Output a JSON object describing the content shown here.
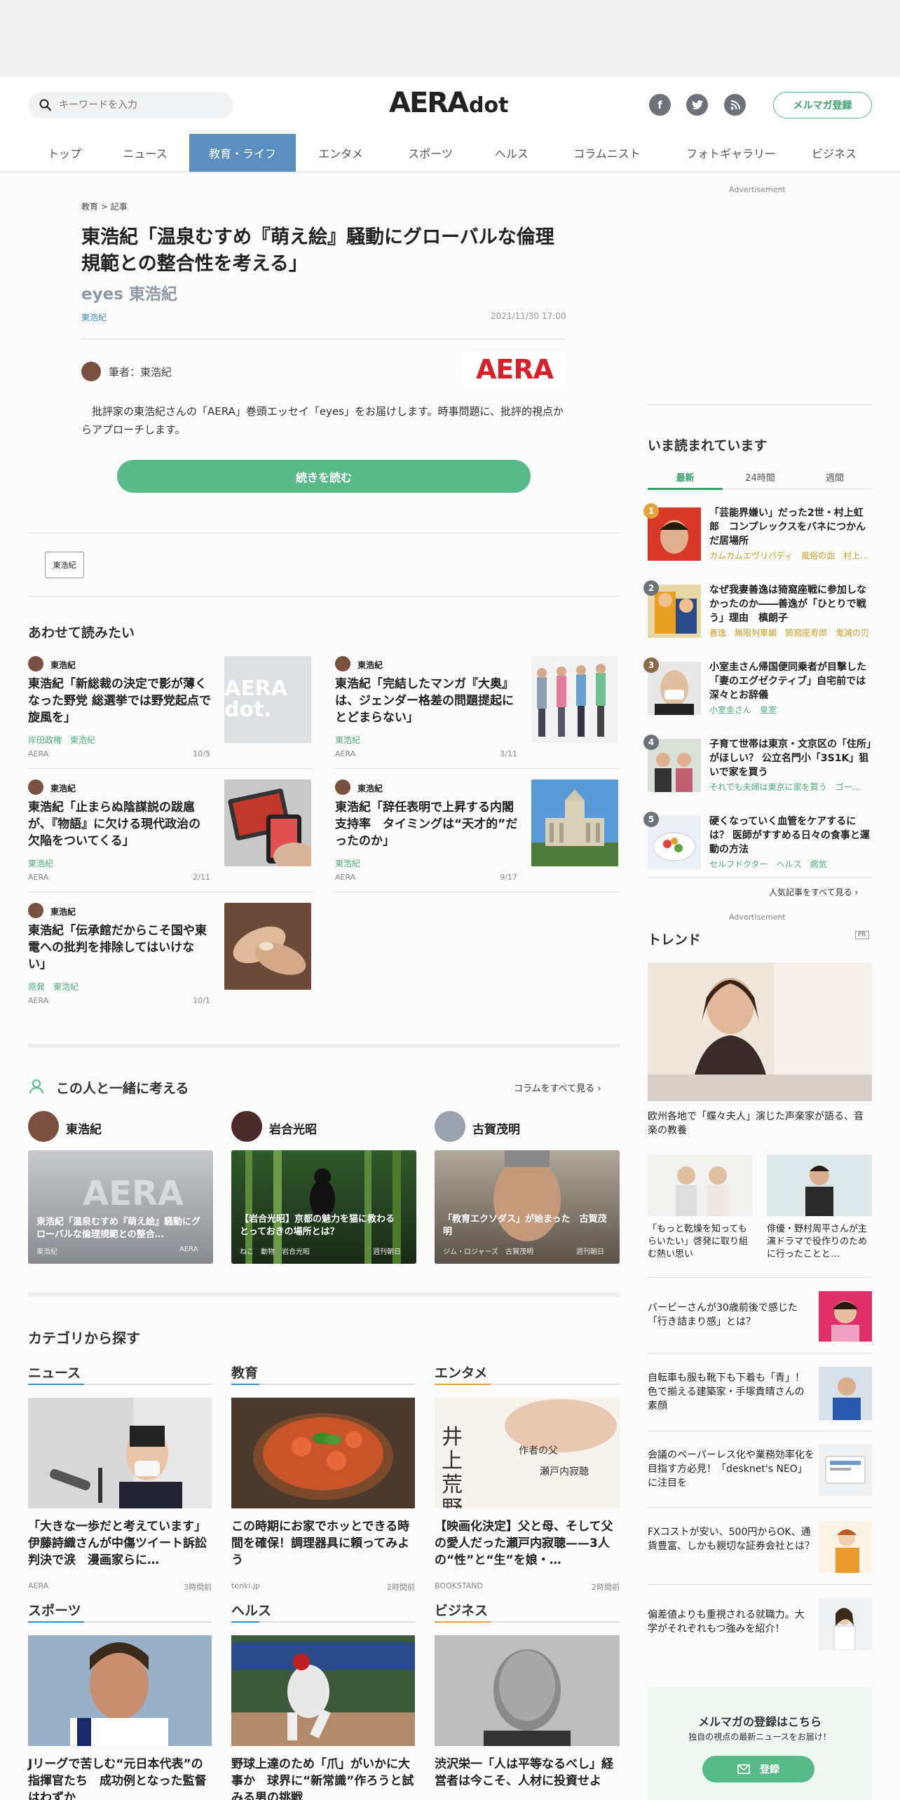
{
  "header": {
    "search_placeholder": "キーワードを入力",
    "logo_main": "AERA",
    "logo_sub": "dot",
    "mailmag_button": "メルマガ登録",
    "social": [
      "f",
      "t",
      "rss"
    ]
  },
  "nav": {
    "items": [
      "トップ",
      "ニュース",
      "教育・ライフ",
      "エンタメ",
      "スポーツ",
      "ヘルス",
      "コラムニスト",
      "フォトギャラリー",
      "ビジネス"
    ],
    "active": "教育・ライフ"
  },
  "article": {
    "breadcrumb": "教育 > 記事",
    "title": "東浩紀「温泉むすめ『萌え絵』騒動にグローバルな倫理規範との整合性を考える」",
    "subtitle": "eyes 東浩紀",
    "author_tag": "東浩紀",
    "date": "2021/11/30 17:00",
    "author_label": "筆者：東浩紀",
    "publisher_logo": "AERA",
    "lead": "批評家の東浩紀さんの「AERA」巻頭エッセイ「eyes」をお届けします。時事問題に、批評的視点からアプローチします。",
    "read_more": "続きを読む",
    "tag": "東浩紀"
  },
  "related": {
    "heading": "あわせて読みたい",
    "items": [
      {
        "author": "東浩紀",
        "title": "東浩紀「新総裁の決定で影が薄くなった野党 総選挙では野党起点で旋風を」",
        "tags": "岸田政権　東浩紀",
        "source": "AERA",
        "date": "10/5",
        "thumb": "AERA dot."
      },
      {
        "author": "東浩紀",
        "title": "東浩紀「完結したマンガ『大奥』は、ジェンダー格差の問題提起にとどまらない」",
        "tags": "東浩紀",
        "source": "AERA",
        "date": "3/11"
      },
      {
        "author": "東浩紀",
        "title": "東浩紀「止まらぬ陰謀説の跋扈が、『物語』に欠ける現代政治の欠陥をついてくる」",
        "tags": "東浩紀",
        "source": "AERA",
        "date": "2/11"
      },
      {
        "author": "東浩紀",
        "title": "東浩紀「辞任表明で上昇する内閣支持率　タイミングは“天才的”だったのか」",
        "tags": "東浩紀",
        "source": "AERA",
        "date": "9/17"
      },
      {
        "author": "東浩紀",
        "title": "東浩紀「伝承館だからこそ国や東電への批判を排除してはいけない」",
        "tags": "原発　東浩紀",
        "source": "AERA",
        "date": "10/1"
      }
    ]
  },
  "think": {
    "heading": "この人と一緒に考える",
    "see_all": "コラムをすべて見る",
    "people": [
      {
        "name": "東浩紀",
        "caption": "東浩紀「温泉むすめ『萌え絵』騒動にグローバルな倫理規範との整合…",
        "tags": "東浩紀",
        "source": "AERA"
      },
      {
        "name": "岩合光昭",
        "caption": "【岩合光昭】京都の魅力を猫に教わる　とっておきの場所とは？",
        "tags": "ねこ　動物　岩合光昭",
        "source": "週刊朝日"
      },
      {
        "name": "古賀茂明",
        "caption": "「教育エクソダス」が始まった　古賀茂明",
        "tags": "ジム・ロジャーズ　古賀茂明",
        "source": "週刊朝日"
      }
    ]
  },
  "categories": {
    "heading": "カテゴリから探す",
    "items": [
      {
        "name": "ニュース",
        "title": "「大きな一歩だと考えています」伊藤詩織さんが中傷ツイート訴訟判決で涙　漫画家らに…",
        "source": "AERA",
        "date": "3時間前",
        "color": "#3b8bc4"
      },
      {
        "name": "教育",
        "title": "この時期にお家でホッとできる時間を確保！調理器具に頼ってみよう",
        "source": "tenki.jp",
        "date": "2時間前",
        "color": "#3b8bc4"
      },
      {
        "name": "エンタメ",
        "title": "【映画化決定】父と母、そして父の愛人だった瀬戸内寂聴——3人の“性”と“生”を娘・…",
        "source": "BOOKSTAND",
        "date": "2時間前",
        "color": "#e2a43a"
      },
      {
        "name": "スポーツ",
        "title": "Jリーグで苦しむ“元日本代表”の指揮官たち　成功例となった監督はわずか",
        "source": "",
        "date": "",
        "color": "#3b8bc4"
      },
      {
        "name": "ヘルス",
        "title": "野球上達のため「爪」がいかに大事か　球界に“新常識”作ろうと試みる男の挑戦",
        "source": "",
        "date": "",
        "color": "#3b8bc4"
      },
      {
        "name": "ビジネス",
        "title": "渋沢栄一「人は平等なるべし」経営者は今こそ、人材に投資せよ",
        "source": "",
        "date": "",
        "color": "#e2a43a"
      }
    ],
    "book_text": "井上荒野"
  },
  "sidebar": {
    "ad_label": "Advertisement",
    "ranking_heading": "いま読まれています",
    "tabs": [
      "最新",
      "24時間",
      "週間"
    ],
    "active_tab": "最新",
    "ranking": [
      {
        "num": "1",
        "title": "「芸能界嫌い」だった2世・村上虹郎　コンプレックスをバネにつかんだ居場所",
        "tags": "カムカムエヴリバディ　風俗の血　村上…",
        "color": "#e2a43a"
      },
      {
        "num": "2",
        "title": "なぜ我妻善逸は猗窩座戦に参加しなかったのか――善逸が「ひとりで戦う」理由　槙朗子",
        "tags": "善逸　無限列車編　猗窩座寿郎　鬼滅の刃",
        "color": "#6d7278"
      },
      {
        "num": "3",
        "title": "小室圭さん帰国便同乗者が目撃した「妻のエグゼクティブ」自宅前では深々とお辞儀",
        "tags": "小室圭さん　皇室",
        "color": "#8a6a4a"
      },
      {
        "num": "4",
        "title": "子育て世帯は東京・文京区の「住所」がほしい？ 公立名門小「3S1K」狙いで家を買う",
        "tags": "それでも夫婦は東京に家を買う　ゴー…",
        "color": "#6d7278"
      },
      {
        "num": "5",
        "title": "硬くなっていく血管をケアするには？ 医師がすすめる日々の食事と運動の方法",
        "tags": "セルフドクター　ヘルス　病気",
        "color": "#6d7278"
      }
    ],
    "ranking_all": "人気記事をすべて見る",
    "ad_label2": "Advertisement",
    "trend_heading": "トレンド",
    "pr": "PR",
    "trend_main": "欧州各地で「蝶々夫人」演じた声楽家が語る、音楽の教養",
    "trend_pair": [
      "「もっと乾燥を知ってもらいたい」啓発に取り組む熱い思い",
      "俳優・野村周平さんが主演ドラマで役作りのために行ったことと…"
    ],
    "trend_list": [
      "バービーさんが30歳前後で感じた「行き詰まり感」とは？",
      "自転車も服も靴下も下着も「青」！色で揃える建築家・手塚貴晴さんの素顔",
      "会議のペーパーレス化や業務効率化を目指す方必見！「desknet's NEO」に注目を",
      "FXコストが安い、500円からOK、通貨豊富、しかも親切な証券会社とは？",
      "偏差値よりも重視される就職力。大学がそれぞれもつ強みを紹介！"
    ],
    "mailmag_title": "メルマガの登録はこちら",
    "mailmag_sub": "独自の視点の最新ニュースをお届け！",
    "mailmag_button": "登録"
  }
}
